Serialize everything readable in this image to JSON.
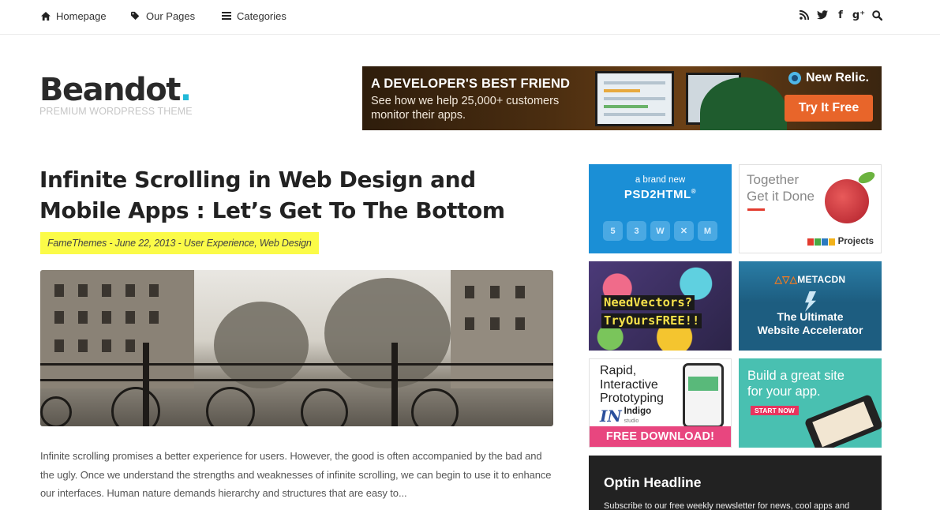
{
  "nav": {
    "items": [
      {
        "label": "Homepage",
        "icon": "home-icon"
      },
      {
        "label": "Our Pages",
        "icon": "tag-icon"
      },
      {
        "label": "Categories",
        "icon": "menu-icon"
      }
    ],
    "social": [
      {
        "icon": "rss-icon",
        "glyph": "≈"
      },
      {
        "icon": "twitter-icon",
        "glyph": "♥"
      },
      {
        "icon": "facebook-icon",
        "glyph": "f"
      },
      {
        "icon": "google-plus-icon",
        "glyph": "g⁺"
      },
      {
        "icon": "search-icon",
        "glyph": "Q"
      }
    ]
  },
  "brand": {
    "name": "Beandot",
    "dot": ".",
    "tagline": "PREMIUM WORDPRESS THEME",
    "accent": "#21b9d8"
  },
  "banner": {
    "headline": "A DEVELOPER'S BEST FRIEND",
    "text": "See how we help 25,000+ customers monitor their apps.",
    "brand": "New Relic.",
    "cta": "Try It Free"
  },
  "article": {
    "title": "Infinite Scrolling in Web Design and Mobile Apps : Let’s Get To The Bottom",
    "meta": {
      "author": "FameThemes",
      "sep1": " - ",
      "date": "June 22, 2013",
      "sep2": " - ",
      "cat1": "User Experience",
      "sep3": ", ",
      "cat2": "Web Design"
    },
    "meta_highlight": "#fbfb48",
    "excerpt": "Infinite scrolling promises a better experience for users. However, the good is often accompanied by the bad and the ugly. Once we understand the strengths and weaknesses of infinite scrolling, we can begin to use it to enhance our interfaces. Human nature demands hierarchy and structures that are easy to..."
  },
  "sidebar": {
    "ads": {
      "psd": {
        "small": "a brand new",
        "big": "PSD2HTML",
        "mark": "®"
      },
      "zoho": {
        "line1": "Together",
        "line2": "Get it Done",
        "brand": "Projects"
      },
      "vectors": {
        "line1": "NeedVectors?",
        "line2": "TryOursFREE!!"
      },
      "metacdn": {
        "logo_mark": "△▽△",
        "logo": "METACDN",
        "line1": "The Ultimate",
        "line2": "Website Accelerator"
      },
      "indigo": {
        "line1": "Rapid,",
        "line2": "Interactive",
        "line3": "Prototyping",
        "brand_mark": "IN",
        "brand": "Indigo",
        "brand_sub": "studio",
        "cta": "FREE DOWNLOAD!"
      },
      "buildsite": {
        "line1": "Build a great site",
        "line2": "for your app.",
        "cta": "START NOW"
      }
    },
    "optin": {
      "headline": "Optin Headline",
      "text": "Subscribe to our free weekly newsletter for news, cool apps and"
    }
  }
}
